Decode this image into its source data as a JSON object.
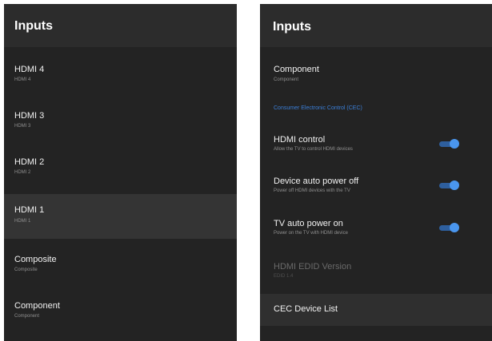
{
  "left": {
    "title": "Inputs",
    "items": [
      {
        "title": "HDMI 4",
        "subtitle": "HDMI 4"
      },
      {
        "title": "HDMI 3",
        "subtitle": "HDMI 3"
      },
      {
        "title": "HDMI 2",
        "subtitle": "HDMI 2"
      },
      {
        "title": "HDMI 1",
        "subtitle": "HDMI 1"
      },
      {
        "title": "Composite",
        "subtitle": "Composite"
      },
      {
        "title": "Component",
        "subtitle": "Component"
      }
    ]
  },
  "right": {
    "title": "Inputs",
    "component": {
      "title": "Component",
      "subtitle": "Component"
    },
    "section_label": "Consumer Electronic Control (CEC)",
    "toggles": [
      {
        "title": "HDMI control",
        "subtitle": "Allow the TV to control HDMI devices",
        "on": true
      },
      {
        "title": "Device auto power off",
        "subtitle": "Power off HDMI devices with the TV",
        "on": true
      },
      {
        "title": "TV auto power on",
        "subtitle": "Power on the TV with HDMI device",
        "on": true
      }
    ],
    "edid": {
      "title": "HDMI EDID Version",
      "subtitle": "EDID 1.4"
    },
    "cec_list": {
      "title": "CEC Device List"
    }
  },
  "colors": {
    "panel_bg": "#232323",
    "header_bg": "#2c2c2c",
    "selected_bg": "#343434",
    "accent": "#3b7fd8",
    "toggle_knob": "#4a96ee"
  }
}
